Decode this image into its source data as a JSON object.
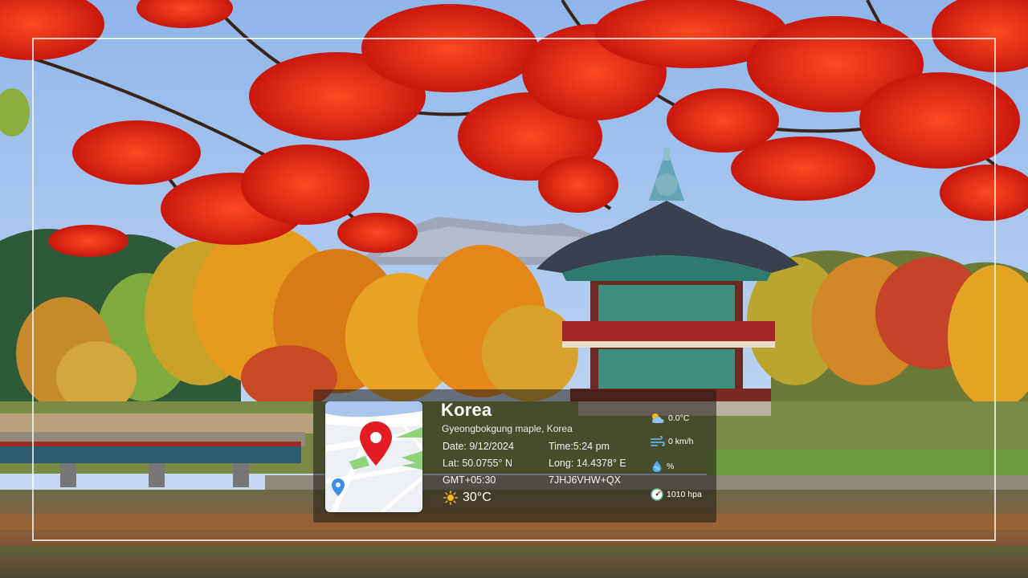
{
  "location": {
    "title": "Korea",
    "subtitle": "Gyeongbokgung maple, Korea"
  },
  "details": {
    "date": "Date: 9/12/2024",
    "time": "Time:5:24 pm",
    "lat": "Lat: 50.0755° N",
    "long": "Long: 14.4378° E",
    "gmt": "GMT+05:30",
    "code": "7JHJ6VHW+QX",
    "temperature": "30°C"
  },
  "weather": {
    "temp": "0.0°C",
    "wind": "0 km/h",
    "humidity": "%",
    "pressure": "1010 hpa"
  },
  "icons": {
    "map_pin": "map-pin-icon",
    "sun": "sun-icon",
    "cloud": "cloud-sun-icon",
    "wind": "wind-icon",
    "humidity": "humidity-icon",
    "pressure": "pressure-gauge-icon"
  },
  "colors": {
    "pin": "#e31b23",
    "card_bg": "rgba(30,25,20,0.55)",
    "maple": "#e8361c",
    "sky": "#a9c8ee"
  }
}
